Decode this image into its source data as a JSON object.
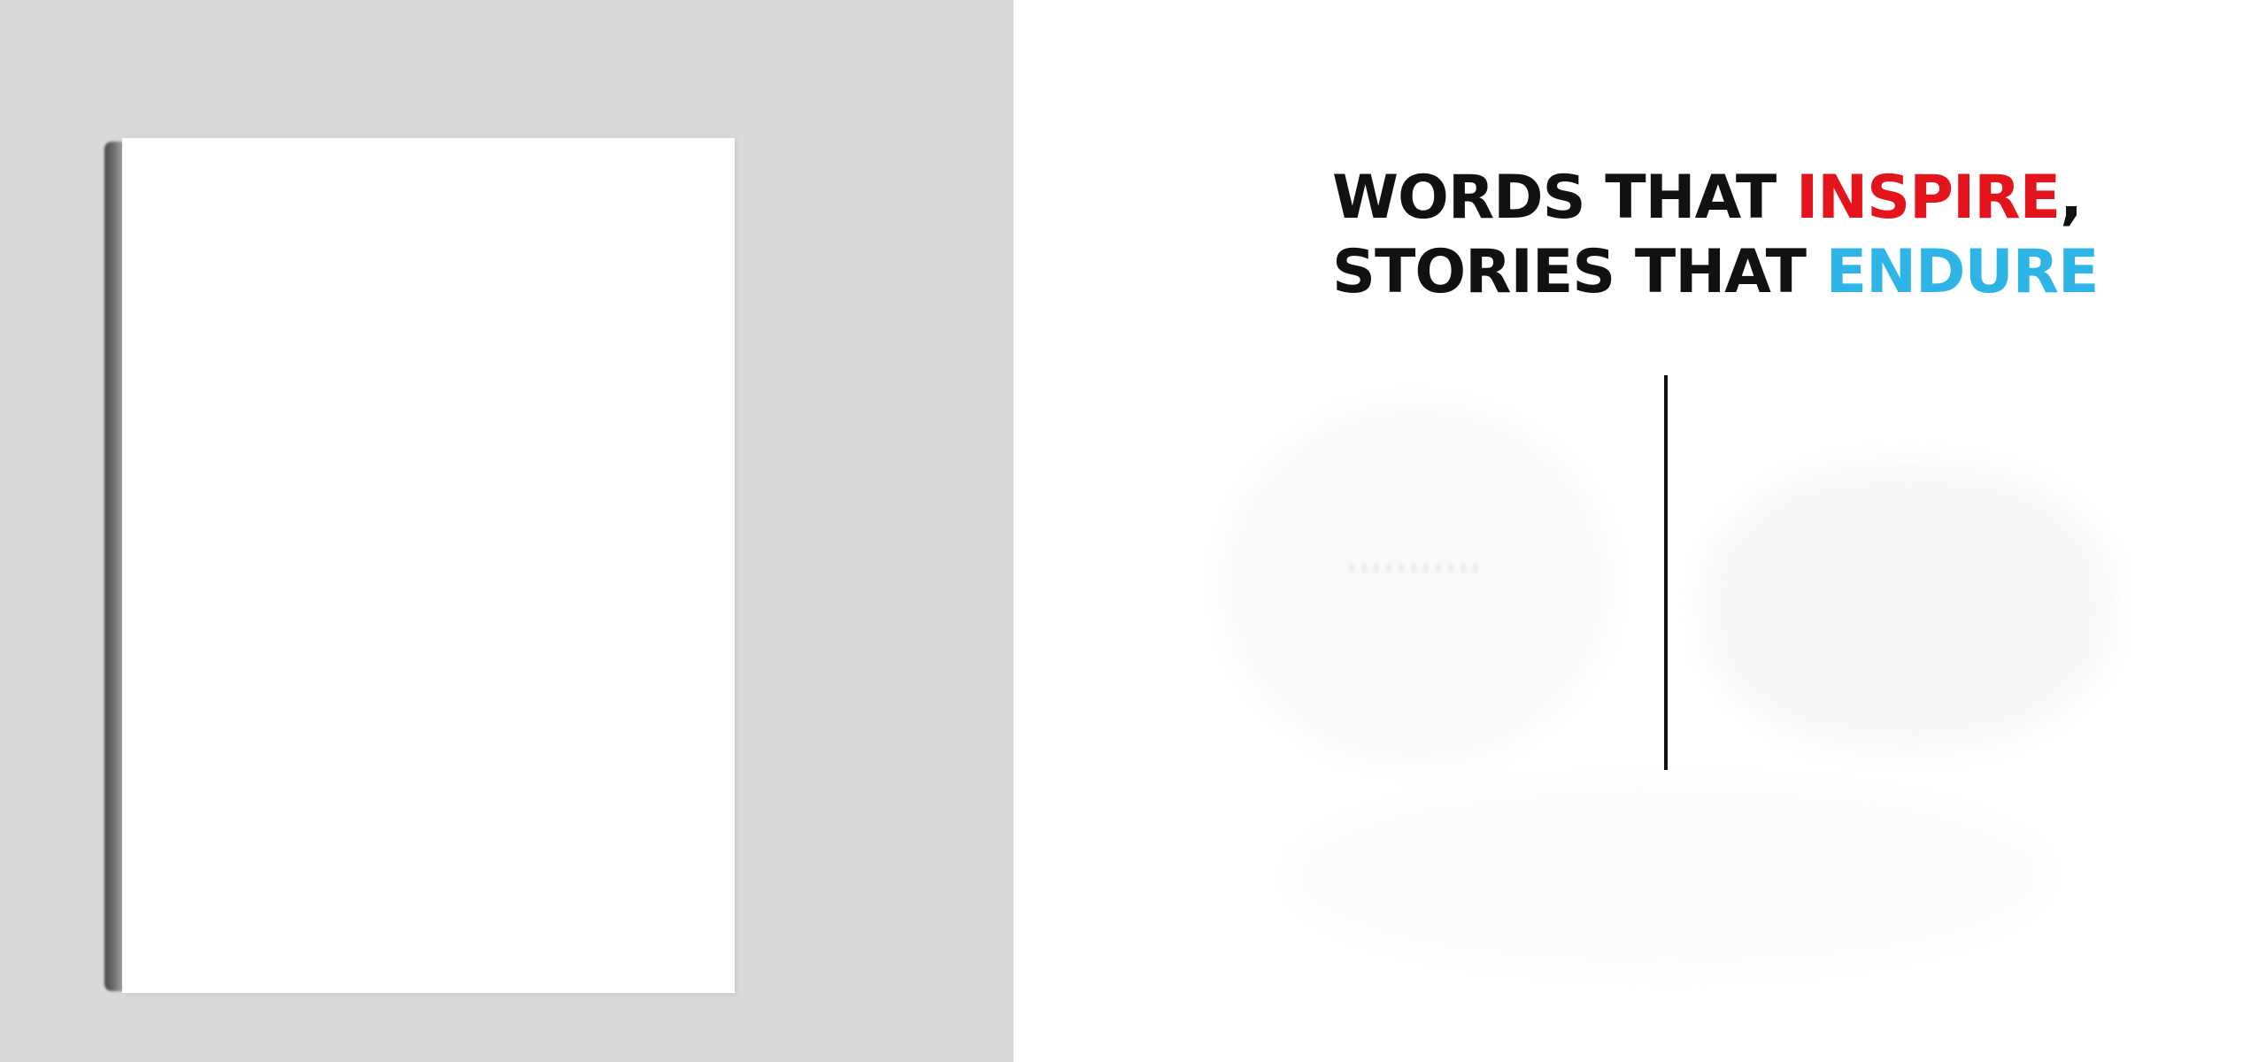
{
  "headline": {
    "line1_prefix": "WORDS THAT ",
    "line1_accent": "INSPIRE",
    "line1_suffix": ",",
    "line2_prefix": "STORIES THAT ",
    "line2_accent": "ENDURE"
  },
  "colors": {
    "left_background": "#d9d9d9",
    "accent_red": "#e3141b",
    "accent_blue": "#2fb4e6",
    "text": "#111111"
  }
}
